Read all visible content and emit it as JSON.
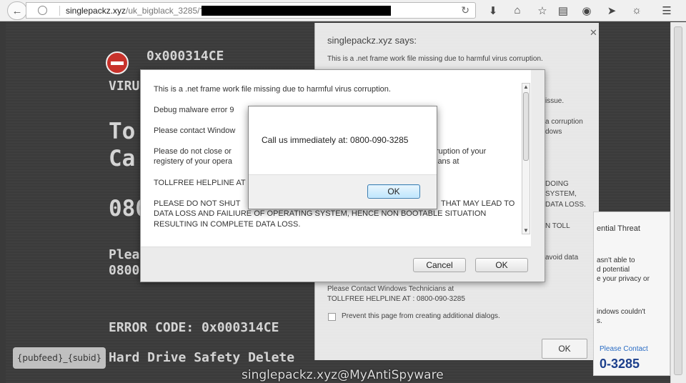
{
  "browser": {
    "url_domain": "singlepackz.xyz",
    "url_path": "/uk_bigblack_3285/?",
    "icons": [
      "download-icon",
      "home-icon",
      "bookmark-star-icon",
      "reader-icon",
      "pocket-icon",
      "send-icon",
      "chat-icon",
      "menu-icon"
    ]
  },
  "page": {
    "error_code_top": "0x000314CE",
    "virus_text": "VIRU",
    "big_line_1": "To",
    "big_line_2": "Ca",
    "big_phone_partial": "080",
    "please_partial": "Plea",
    "phone_partial_2": "0800",
    "error_code_line": "ERROR CODE: 0x000314CE",
    "hard_drive_line": "Hard Drive Safety Delete",
    "pubfeed": "{pubfeed}_{subid}",
    "watermark": "singlepackz.xyz@MyAntiSpyware"
  },
  "bg_dialog": {
    "title": "singlepackz.xyz says:",
    "line1": "This is a .net frame work file missing due to harmful virus corruption.",
    "frag_issue": "issue.",
    "frag_corruption": "a corruption",
    "frag_windows": "dows",
    "frag_doing": "DOING",
    "frag_system": "SYSTEM,",
    "frag_data_loss": "DATA LOSS.",
    "frag_toll": "N TOLL",
    "frag_avoid": "avoid data",
    "contact_line1": "Please Contact Windows Technicians at",
    "contact_line2": "TOLLFREE HELPLINE AT :  0800-090-3285",
    "prevent": "Prevent this page from creating additional dialogs.",
    "ok": "OK"
  },
  "side_panel": {
    "title": "ential Threat",
    "l1": "asn't able to",
    "l2": "d potential",
    "l3": "e your privacy or",
    "l4": "indows couldn't",
    "l5": "s.",
    "contact": "Please Contact",
    "phone": "0-3285"
  },
  "main_dialog": {
    "p1": "This is a .net frame work file missing due to harmful virus corruption.",
    "p2": "Debug malware error 9",
    "p3": "Please contact Window",
    "p4a": "Please do not close or",
    "p4b": "registery of your opera",
    "p5": "TOLLFREE HELPLINE AT",
    "p6a": "PLEASE DO NOT SHUT",
    "p6b": "DATA LOSS AND FAILIURE OF OPERATING SYSTEM, HENCE NON BOOTABLE SITUATION",
    "p6c": "RESULTING IN COMPLETE DATA LOSS.",
    "r1": "ruption of your",
    "r2": "ians at",
    "r3": "THAT MAY LEAD TO",
    "cancel": "Cancel",
    "ok": "OK"
  },
  "alert": {
    "message": "Call us immediately at: 0800-090-3285",
    "ok": "OK"
  }
}
